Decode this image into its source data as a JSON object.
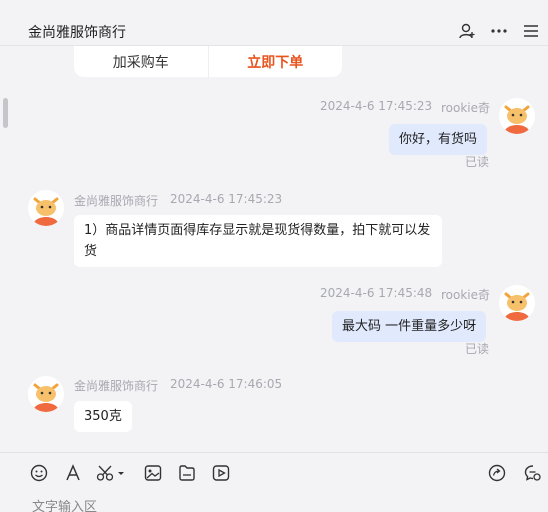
{
  "header": {
    "title": "金尚雅服饰商行",
    "icons": [
      "add-contact-icon",
      "more-icon",
      "menu-icon"
    ]
  },
  "order_card": {
    "add_cart_label": "加采购车",
    "buy_now_label": "立即下单"
  },
  "messages": [
    {
      "sender": "rookie奇",
      "time": "2024-4-6 17:45:23",
      "text": "你好，有货吗",
      "status": "已读",
      "from_me": true
    },
    {
      "sender": "金尚雅服饰商行",
      "time": "2024-4-6 17:45:23",
      "text": "1）商品详情页面得库存显示就是现货得数量，拍下就可以发货",
      "from_me": false
    },
    {
      "sender": "rookie奇",
      "time": "2024-4-6 17:45:48",
      "text": "最大码 一件重量多少呀",
      "status": "已读",
      "from_me": true
    },
    {
      "sender": "金尚雅服饰商行",
      "time": "2024-4-6 17:46:05",
      "text": "350克",
      "from_me": false
    }
  ],
  "toolbar": {
    "icons": [
      "emoji-icon",
      "font-icon",
      "scissors-icon",
      "image-icon",
      "file-icon",
      "video-icon",
      "quick-reply-icon",
      "chat-settings-icon"
    ]
  },
  "input": {
    "placeholder": "文字输入区"
  }
}
